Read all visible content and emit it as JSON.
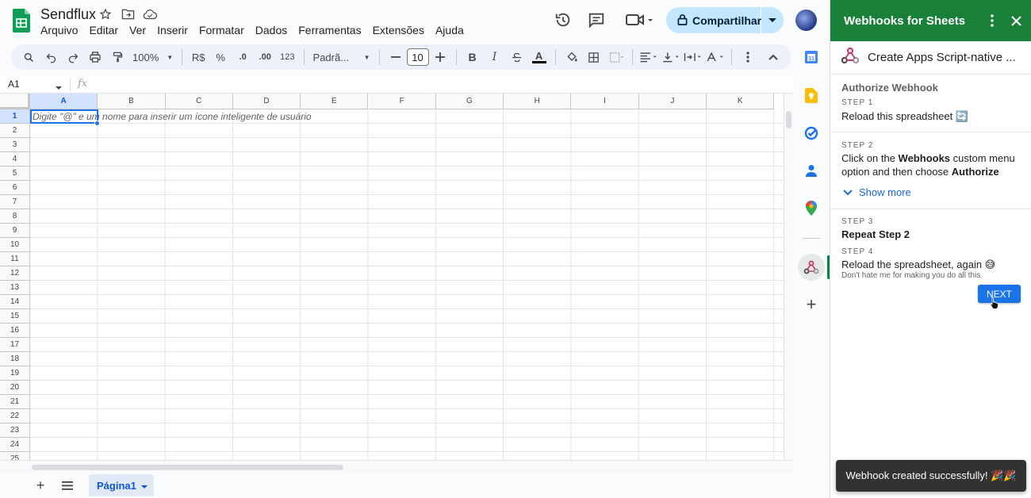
{
  "header": {
    "doc_title": "Sendflux",
    "menu": [
      "Arquivo",
      "Editar",
      "Ver",
      "Inserir",
      "Formatar",
      "Dados",
      "Ferramentas",
      "Extensões",
      "Ajuda"
    ],
    "share_label": "Compartilhar"
  },
  "toolbar": {
    "zoom": "100%",
    "currency": "R$",
    "percent": "%",
    "decrease_decimal": ".0",
    "increase_decimal": ".00",
    "number_format": "123",
    "font": "Padrã...",
    "font_size": "10"
  },
  "formula_bar": {
    "name_box": "A1",
    "fx": "fx"
  },
  "grid": {
    "columns": [
      "A",
      "B",
      "C",
      "D",
      "E",
      "F",
      "G",
      "H",
      "I",
      "J",
      "K"
    ],
    "rows": [
      "1",
      "2",
      "3",
      "4",
      "5",
      "6",
      "7",
      "8",
      "9",
      "10",
      "11",
      "12",
      "13",
      "14",
      "15",
      "16",
      "17",
      "18",
      "19",
      "20",
      "21",
      "22",
      "23",
      "24",
      "25"
    ],
    "selected_cell": "A1",
    "cell_hint": "Digite \"@\" e um nome para inserir um ícone inteligente de usuário"
  },
  "sheets": {
    "active": "Página1"
  },
  "panel": {
    "title": "Webhooks for Sheets",
    "subtitle": "Create Apps Script-native ...",
    "section_title": "Authorize Webhook",
    "step1_label": "STEP 1",
    "step1_text": "Reload this spreadsheet 🔄",
    "step2_label": "STEP 2",
    "step2_pre": "Click on the ",
    "step2_bold1": "Webhooks",
    "step2_mid": " custom menu option and then choose ",
    "step2_bold2": "Authorize",
    "show_more": "Show more",
    "step3_label": "STEP 3",
    "step3_text": "Repeat Step 2",
    "step4_label": "STEP 4",
    "step4_text": "Reload the spreadsheet, again 😅",
    "step4_sub": "Don't hate me for making you do all this",
    "next_label": "NEXT"
  },
  "toast": "Webhook created successfully! 🎉🎉",
  "colors": {
    "panel_header": "#188038",
    "accent": "#1a73e8",
    "share_bg": "#c2e7ff"
  }
}
